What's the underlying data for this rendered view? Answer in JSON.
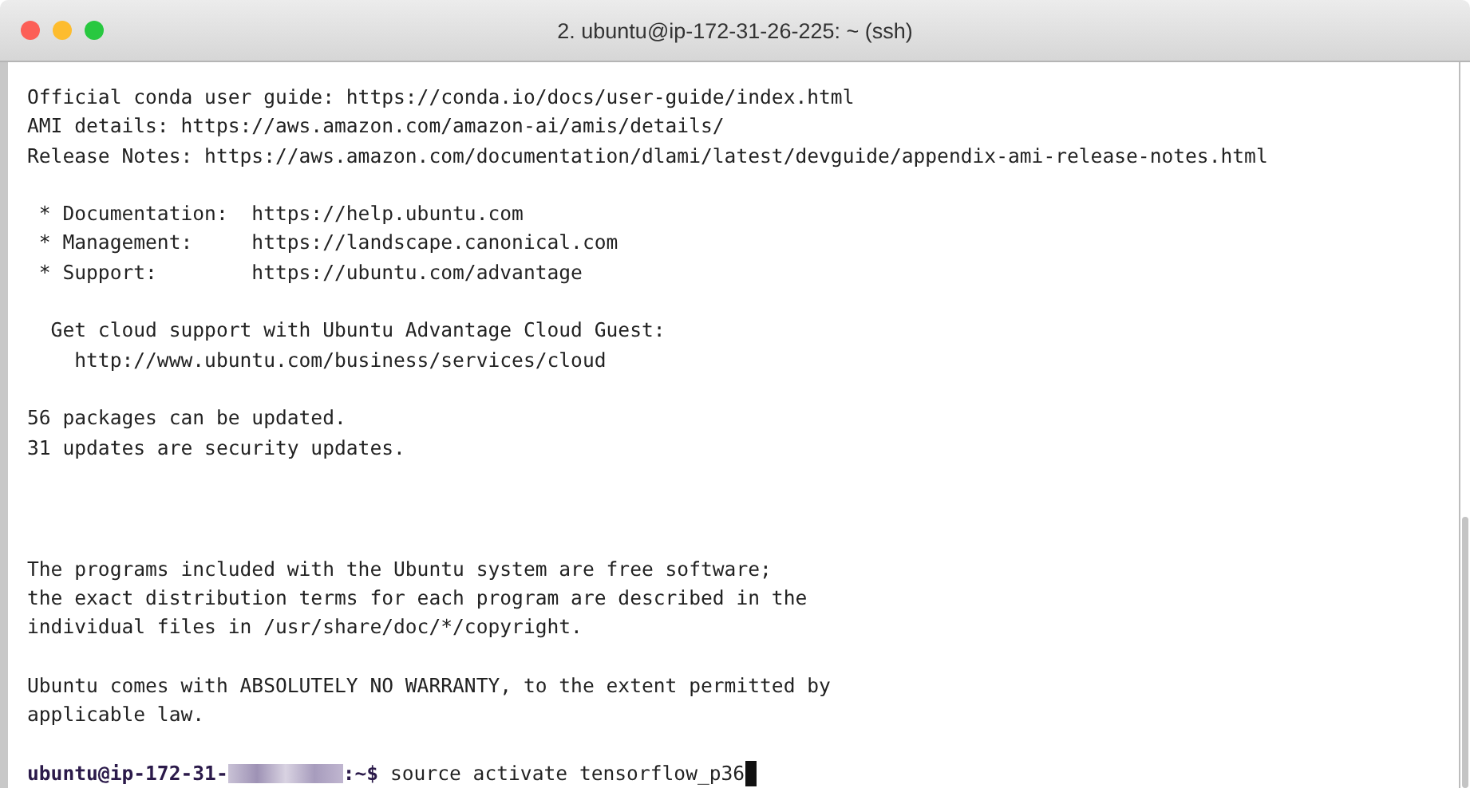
{
  "window": {
    "title": "2. ubuntu@ip-172-31-26-225: ~ (ssh)"
  },
  "output_top": [
    {
      "lines": [
        "Official conda user guide: https://conda.io/docs/user-guide/index.html",
        "AMI details: https://aws.amazon.com/amazon-ai/amis/details/",
        "Release Notes: https://aws.amazon.com/documentation/dlami/latest/devguide/appendix-ami-release-notes.html"
      ]
    },
    {
      "lines": [
        " * Documentation:  https://help.ubuntu.com",
        " * Management:     https://landscape.canonical.com",
        " * Support:        https://ubuntu.com/advantage"
      ]
    },
    {
      "lines": [
        "  Get cloud support with Ubuntu Advantage Cloud Guest:",
        "    http://www.ubuntu.com/business/services/cloud"
      ]
    },
    {
      "lines": [
        "56 packages can be updated.",
        "31 updates are security updates."
      ]
    }
  ],
  "output_bottom": [
    {
      "lines": [
        "The programs included with the Ubuntu system are free software;",
        "the exact distribution terms for each program are described in the",
        "individual files in /usr/share/doc/*/copyright."
      ]
    },
    {
      "lines": [
        "Ubuntu comes with ABSOLUTELY NO WARRANTY, to the extent permitted by",
        "applicable law."
      ]
    }
  ],
  "prompt": {
    "user_host": "ubuntu@ip-172-31-",
    "suffix": ":~$",
    "command": "source activate tensorflow_p36"
  }
}
